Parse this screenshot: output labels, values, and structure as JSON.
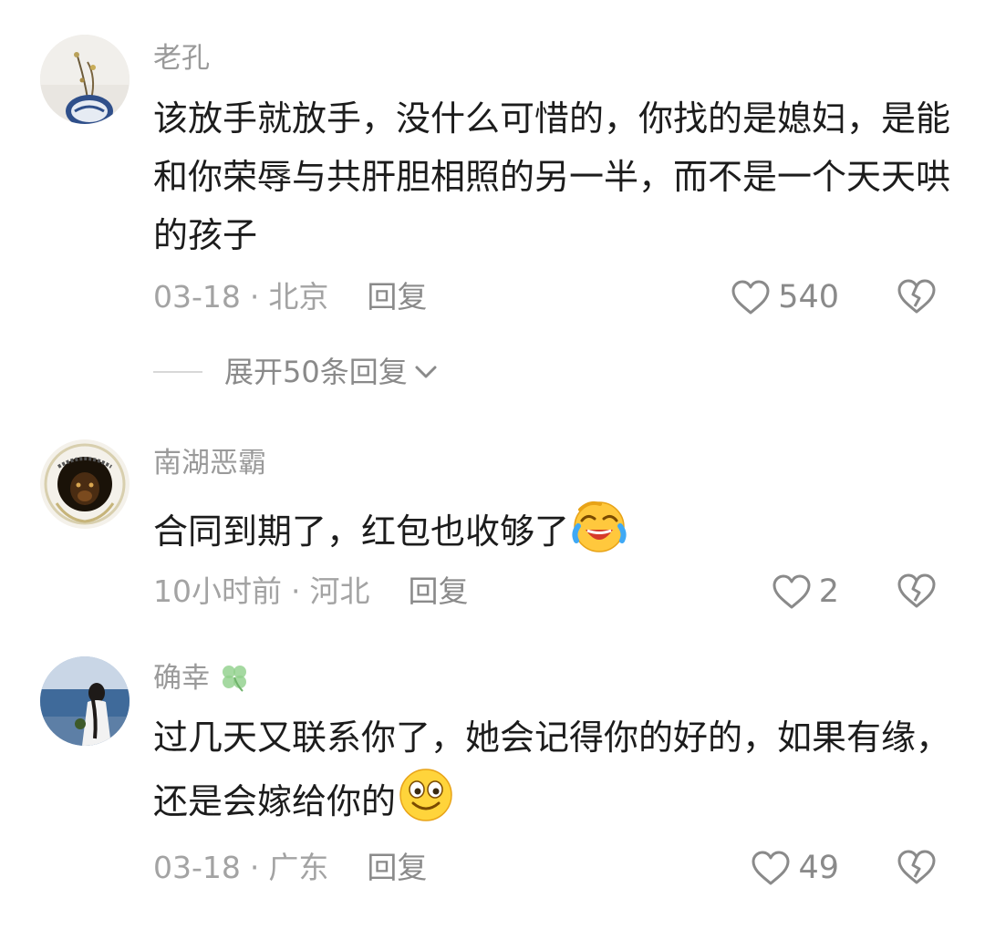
{
  "comments": [
    {
      "username": "老孔",
      "text": "该放手就放手，没什么可惜的，你找的是媳妇，是能和你荣辱与共肝胆相照的另一半，而不是一个天天哄的孩子",
      "date": "03-18",
      "separator": "·",
      "location": "北京",
      "reply_label": "回复",
      "likes": "540",
      "expand_label": "展开50条回复"
    },
    {
      "username": "南湖恶霸",
      "text": "合同到期了，红包也收够了",
      "emoji": "laughing-crying-emoji",
      "date": "10小时前",
      "separator": "·",
      "location": "河北",
      "reply_label": "回复",
      "likes": "2"
    },
    {
      "username": "确幸",
      "username_icon": "four-leaf-clover-icon",
      "text": "过几天又联系你了，她会记得你的好的，如果有缘，还是会嫁给你的",
      "emoji": "smiling-emoji",
      "date": "03-18",
      "separator": "·",
      "location": "广东",
      "reply_label": "回复",
      "likes": "49"
    }
  ],
  "colors": {
    "text": "#1c1c1c",
    "meta": "#a3a3a3",
    "icon": "#8a8a8a"
  }
}
